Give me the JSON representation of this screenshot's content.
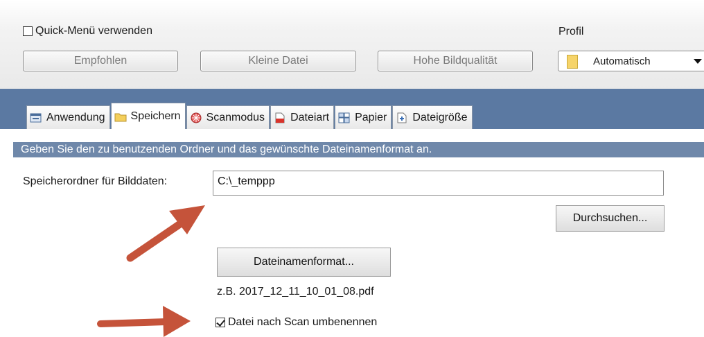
{
  "quick_menu": {
    "label": "Quick-Menü verwenden",
    "checked": false
  },
  "presets": [
    {
      "label": "Empfohlen"
    },
    {
      "label": "Kleine Datei"
    },
    {
      "label": "Hohe Bildqualität"
    }
  ],
  "profile": {
    "label": "Profil",
    "value": "Automatisch",
    "icon": "folder-icon"
  },
  "tabs": [
    {
      "label": "Anwendung",
      "icon": "application-icon"
    },
    {
      "label": "Speichern",
      "icon": "folder-icon",
      "active": true
    },
    {
      "label": "Scanmodus",
      "icon": "scanmode-icon"
    },
    {
      "label": "Dateiart",
      "icon": "pdf-file-icon"
    },
    {
      "label": "Papier",
      "icon": "paper-icon"
    },
    {
      "label": "Dateigröße",
      "icon": "filesize-icon"
    }
  ],
  "info": "Geben Sie den zu benutzenden Ordner und das gewünschte Dateinamenformat an.",
  "save": {
    "folder_label": "Speicherordner für Bilddaten:",
    "folder_value": "C:\\_temppp",
    "browse_label": "Durchsuchen...",
    "filename_format_label": "Dateinamenformat...",
    "example": "z.B. 2017_12_11_10_01_08.pdf",
    "rename_label": "Datei nach Scan umbenennen",
    "rename_checked": true
  },
  "colors": {
    "band": "#5b79a2",
    "infobar": "#6f88aa",
    "arrow": "#c5533a"
  }
}
